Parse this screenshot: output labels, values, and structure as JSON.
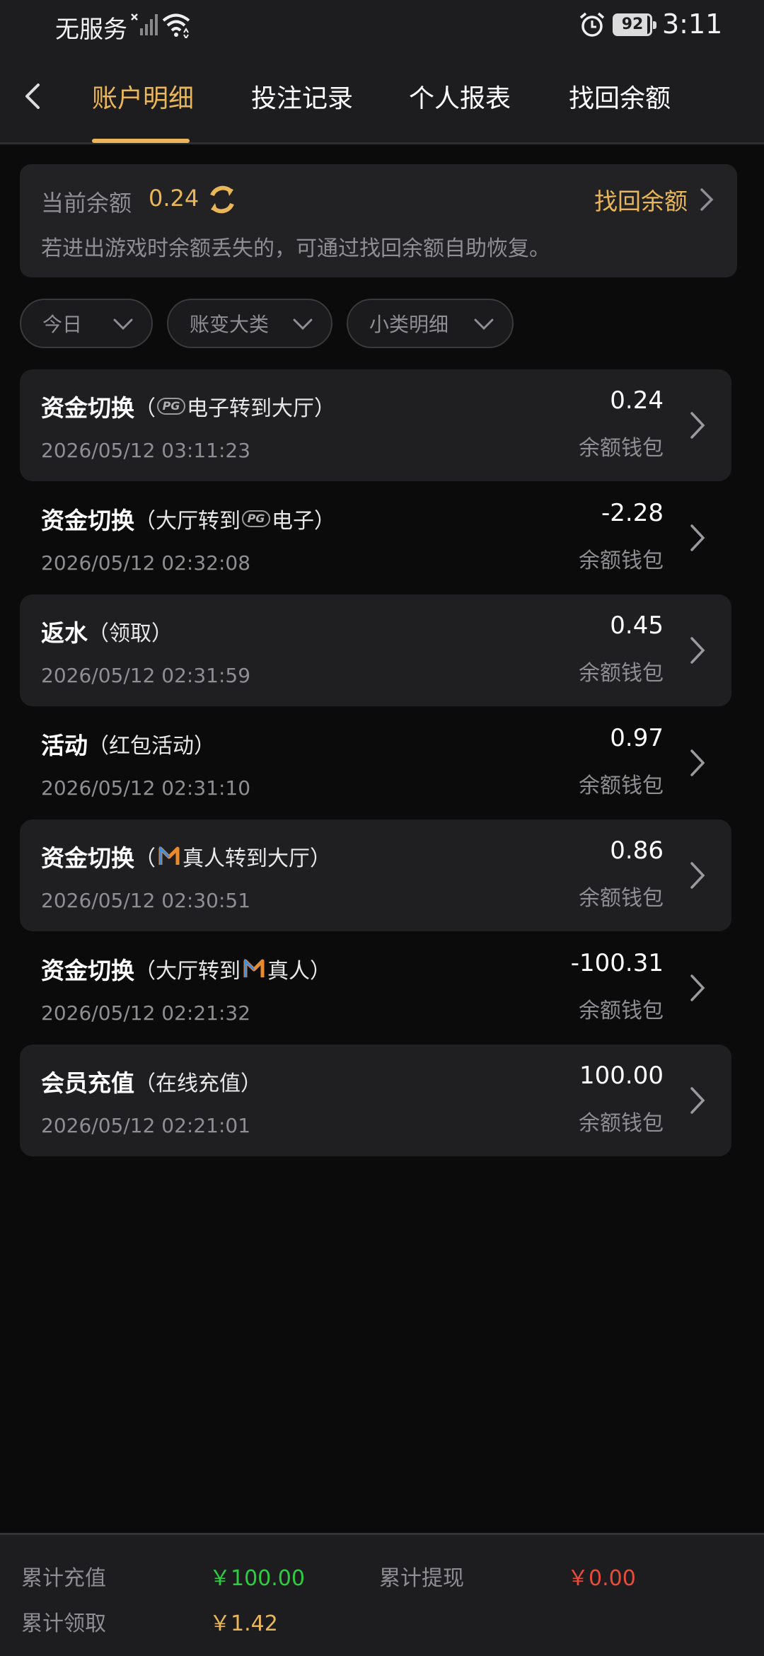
{
  "status_bar": {
    "carrier": "无服务",
    "battery": "92",
    "time": "3:11"
  },
  "tabs": [
    {
      "label": "账户明细",
      "active": true
    },
    {
      "label": "投注记录",
      "active": false
    },
    {
      "label": "个人报表",
      "active": false
    },
    {
      "label": "找回余额",
      "active": false
    }
  ],
  "balance": {
    "label": "当前余额",
    "value": "0.24",
    "recover_label": "找回余额",
    "hint": "若进出游戏时余额丢失的，可通过找回余额自助恢复。"
  },
  "filters": [
    {
      "label": "今日"
    },
    {
      "label": "账变大类"
    },
    {
      "label": "小类明细"
    }
  ],
  "records": [
    {
      "title": "资金切换",
      "sub_pre": "（",
      "sub_logo": "pg",
      "sub_post": "电子转到大厅）",
      "time": "2026/05/12 03:11:23",
      "amount": "0.24",
      "wallet": "余额钱包"
    },
    {
      "title": "资金切换",
      "sub_pre": "（大厅转到",
      "sub_logo": "pg",
      "sub_post": "电子）",
      "time": "2026/05/12 02:32:08",
      "amount": "-2.28",
      "wallet": "余额钱包"
    },
    {
      "title": "返水",
      "sub_pre": "（领取）",
      "sub_logo": "",
      "sub_post": "",
      "time": "2026/05/12 02:31:59",
      "amount": "0.45",
      "wallet": "余额钱包"
    },
    {
      "title": "活动",
      "sub_pre": "（红包活动）",
      "sub_logo": "",
      "sub_post": "",
      "time": "2026/05/12 02:31:10",
      "amount": "0.97",
      "wallet": "余额钱包"
    },
    {
      "title": "资金切换",
      "sub_pre": "（",
      "sub_logo": "m",
      "sub_post": "真人转到大厅）",
      "time": "2026/05/12 02:30:51",
      "amount": "0.86",
      "wallet": "余额钱包"
    },
    {
      "title": "资金切换",
      "sub_pre": "（大厅转到",
      "sub_logo": "m",
      "sub_post": "真人）",
      "time": "2026/05/12 02:21:32",
      "amount": "-100.31",
      "wallet": "余额钱包"
    },
    {
      "title": "会员充值",
      "sub_pre": "（在线充值）",
      "sub_logo": "",
      "sub_post": "",
      "time": "2026/05/12 02:21:01",
      "amount": "100.00",
      "wallet": "余额钱包"
    }
  ],
  "pg_logo_text": "PG",
  "summary": {
    "total_deposit_label": "累计充值",
    "total_deposit": "￥100.00",
    "total_withdraw_label": "累计提现",
    "total_withdraw": "￥0.00",
    "total_claim_label": "累计领取",
    "total_claim": "￥1.42"
  },
  "colors": {
    "accent": "#e9b659",
    "positive": "#2ecc40",
    "negative": "#e74c3c"
  }
}
